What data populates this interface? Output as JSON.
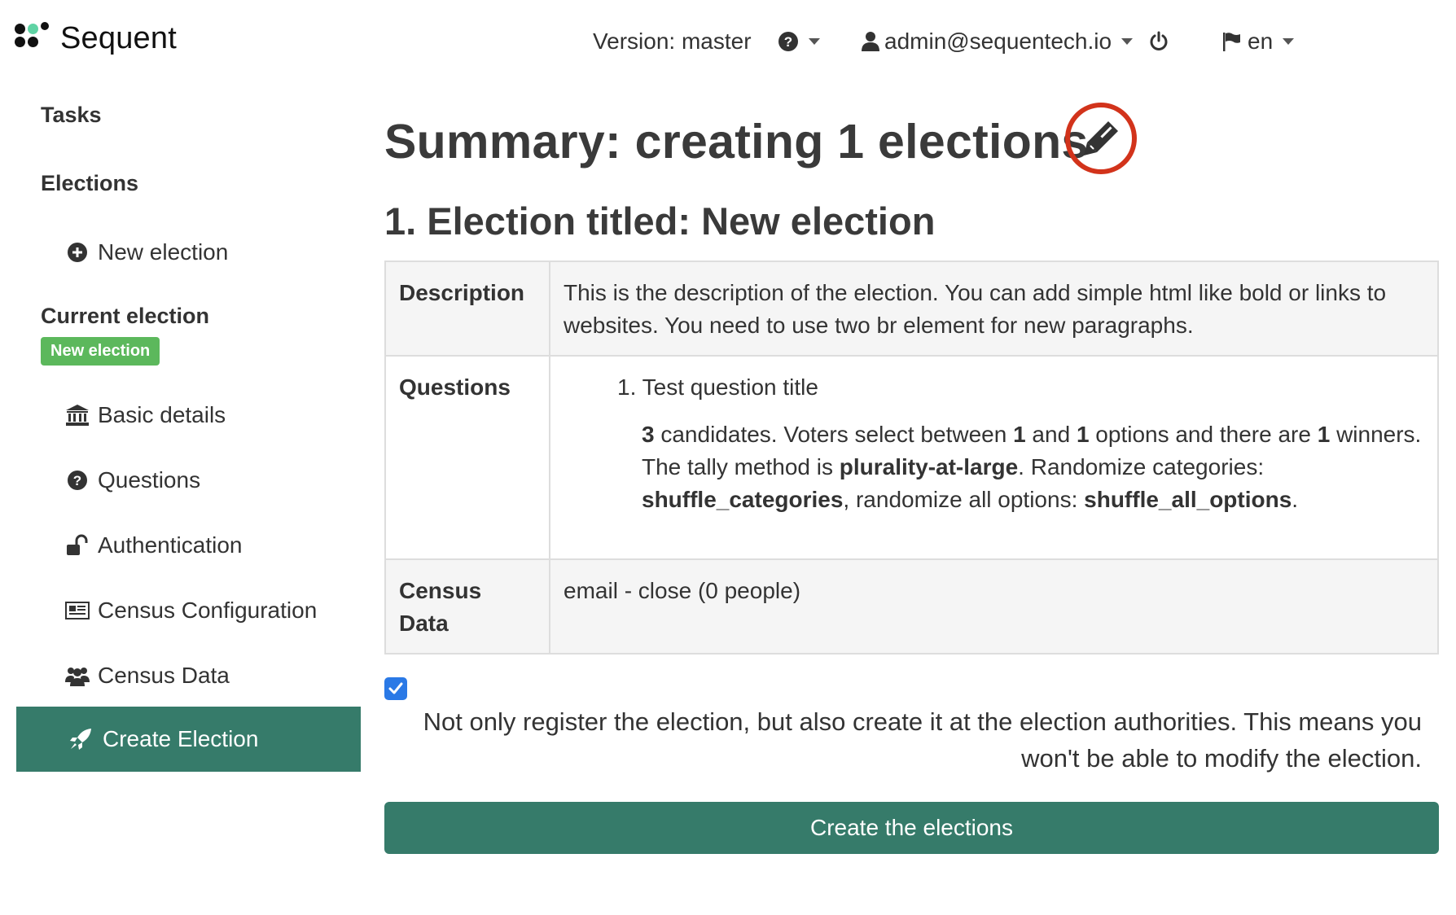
{
  "brand": {
    "name": "Sequent"
  },
  "header": {
    "version": "Version: master",
    "user": "admin@sequentech.io",
    "language": "en"
  },
  "sidebar": {
    "tasks": "Tasks",
    "elections": "Elections",
    "new_election": "New election",
    "current_election": "Current election",
    "current_badge": "New election",
    "items": [
      {
        "label": "Basic details",
        "icon": "bank-icon"
      },
      {
        "label": "Questions",
        "icon": "question-circle-icon"
      },
      {
        "label": "Authentication",
        "icon": "unlock-icon"
      },
      {
        "label": "Census Configuration",
        "icon": "newspaper-icon"
      },
      {
        "label": "Census Data",
        "icon": "users-icon"
      }
    ],
    "active": {
      "label": "Create Election",
      "icon": "rocket-icon"
    }
  },
  "main": {
    "title": "Summary: creating 1 elections",
    "election_title": "1. Election titled: New election",
    "table": {
      "description_label": "Description",
      "description_value": "This is the description of the election. You can add simple html like bold or links to websites. You need to use two br element for new paragraphs.",
      "questions_label": "Questions",
      "question_title": "1. Test question title",
      "question_detail": {
        "candidates": "3",
        "t1": " candidates. Voters select between ",
        "min": "1",
        "t2": " and ",
        "max": "1",
        "t3": " options and there are ",
        "winners": "1",
        "t4": " winners. The tally method is ",
        "tally": "plurality-at-large",
        "t5": ". Randomize categories: ",
        "shuffle_categories": "shuffle_categories",
        "t6": ", randomize all options: ",
        "shuffle_all": "shuffle_all_options",
        "t7": "."
      },
      "census_label_1": "Census",
      "census_label_2": "Data",
      "census_value": "email - close (0 people)"
    },
    "checkbox_checked": true,
    "notice": "Not only register the election, but also create it at the election authorities. This means you won't be able to modify the election.",
    "create_button": "Create the elections"
  },
  "colors": {
    "accent": "#367b6a",
    "badge": "#5cb85c",
    "highlight_ring": "#d2331b",
    "checkbox": "#2a79e6"
  }
}
